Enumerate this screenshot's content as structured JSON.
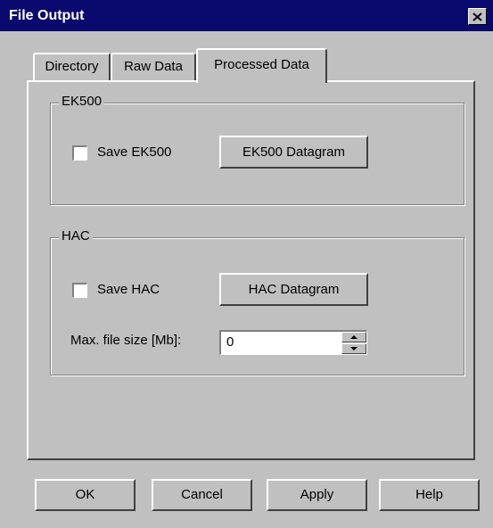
{
  "window": {
    "title": "File Output"
  },
  "tabs": [
    {
      "label": "Directory"
    },
    {
      "label": "Raw Data"
    },
    {
      "label": "Processed Data",
      "active": true
    }
  ],
  "ek500": {
    "group_label": "EK500",
    "save_checkbox_label": "Save EK500",
    "save_checked": false,
    "datagram_button": "EK500 Datagram"
  },
  "hac": {
    "group_label": "HAC",
    "save_checkbox_label": "Save HAC",
    "save_checked": false,
    "datagram_button": "HAC Datagram",
    "max_file_size_label": "Max. file size [Mb]:",
    "max_file_size_value": "0"
  },
  "buttons": {
    "ok": "OK",
    "cancel": "Cancel",
    "apply": "Apply",
    "help": "Help"
  },
  "icons": {
    "close": "close-icon",
    "spin_up": "spin-up-arrow-icon",
    "spin_down": "spin-down-arrow-icon"
  }
}
